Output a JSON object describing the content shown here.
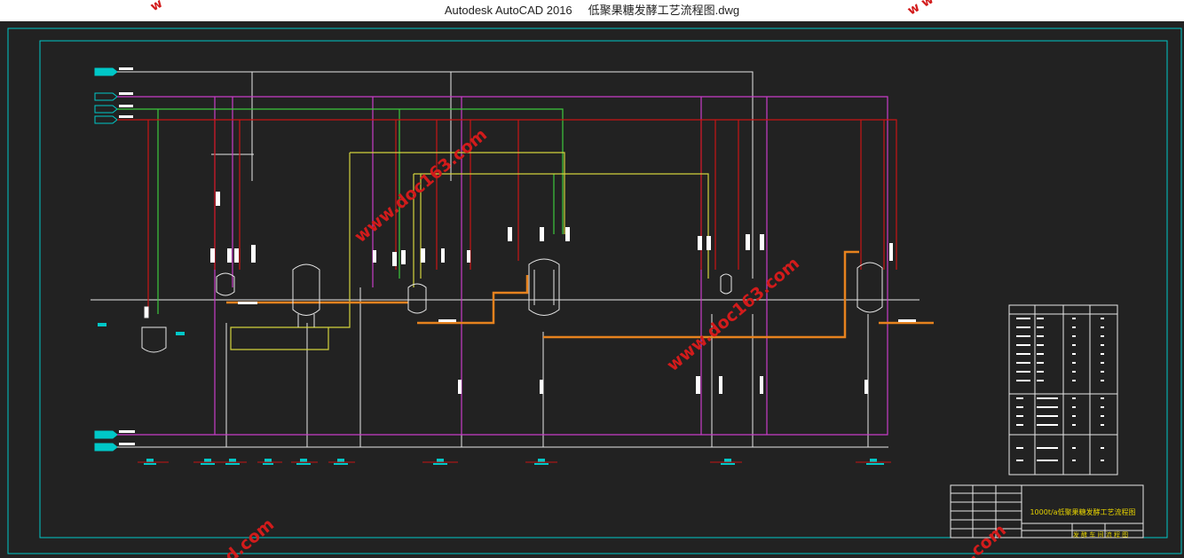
{
  "window": {
    "app_name": "Autodesk AutoCAD 2016",
    "document_name": "低聚果糖发酵工艺流程图.dwg"
  },
  "watermarks": {
    "top_left": "w",
    "top_right": "w w",
    "center_upper": "www.doc163.com",
    "center_right": "www.doc163.com",
    "bottom_left": "d.com",
    "bottom_right": ".com"
  },
  "drawing": {
    "title_block_heading": "1000t/a低聚果糖发酵工艺流程图",
    "title_block_sub": "发 酵 车 间 流 程 图"
  },
  "colors": {
    "background": "#222222",
    "frame": "#00c8c8",
    "pipe_red": "#c81414",
    "pipe_magenta": "#c83cc8",
    "pipe_green": "#3cc83c",
    "pipe_yellow": "#d2d23c",
    "pipe_white": "#e8e8e8",
    "pipe_orange": "#e6821e",
    "watermark": "#d21b1b"
  }
}
